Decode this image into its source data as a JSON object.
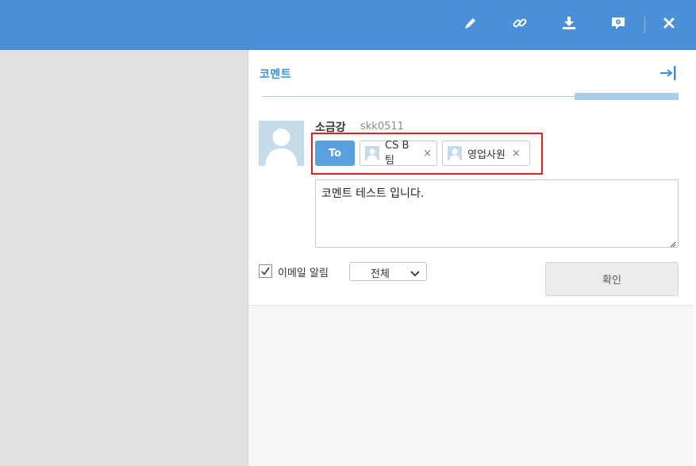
{
  "colors": {
    "topbar": "#4a90d9",
    "accent": "#3a8fd6",
    "highlight_border": "#e02020"
  },
  "toolbar": {
    "icons": [
      "pencil-icon",
      "link-icon",
      "download-icon",
      "settings-chat-icon",
      "close-icon"
    ]
  },
  "panel": {
    "title": "코멘트",
    "collapse_icon": "collapse-right-icon"
  },
  "author": {
    "name": "소금강",
    "id": "skk0511"
  },
  "recipients": {
    "to_label": "To",
    "chips": [
      {
        "label": "CS B팀",
        "remove": "×"
      },
      {
        "label": "영업사원",
        "remove": "×"
      }
    ]
  },
  "comment": {
    "text": "코멘트 테스트 입니다."
  },
  "options": {
    "email_label": "이메일 알림",
    "email_checked": true,
    "scope_value": "전체"
  },
  "actions": {
    "confirm_label": "확인"
  }
}
